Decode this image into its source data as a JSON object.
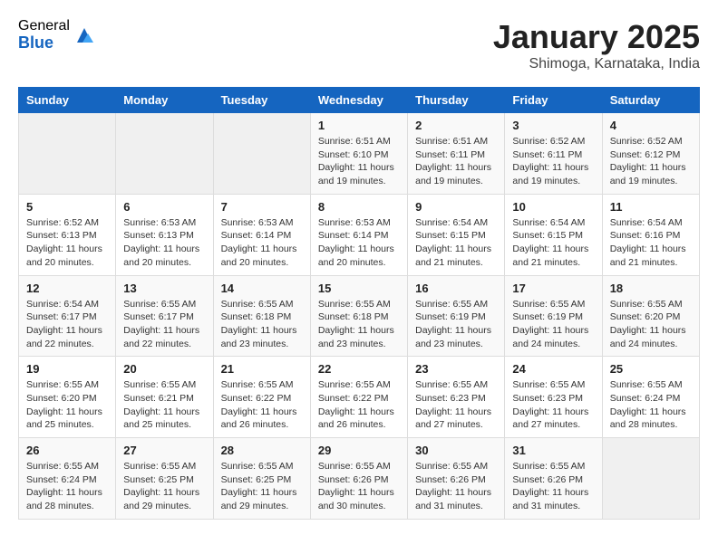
{
  "header": {
    "logo_general": "General",
    "logo_blue": "Blue",
    "month_title": "January 2025",
    "subtitle": "Shimoga, Karnataka, India"
  },
  "weekdays": [
    "Sunday",
    "Monday",
    "Tuesday",
    "Wednesday",
    "Thursday",
    "Friday",
    "Saturday"
  ],
  "weeks": [
    [
      {
        "day": "",
        "info": ""
      },
      {
        "day": "",
        "info": ""
      },
      {
        "day": "",
        "info": ""
      },
      {
        "day": "1",
        "info": "Sunrise: 6:51 AM\nSunset: 6:10 PM\nDaylight: 11 hours\nand 19 minutes."
      },
      {
        "day": "2",
        "info": "Sunrise: 6:51 AM\nSunset: 6:11 PM\nDaylight: 11 hours\nand 19 minutes."
      },
      {
        "day": "3",
        "info": "Sunrise: 6:52 AM\nSunset: 6:11 PM\nDaylight: 11 hours\nand 19 minutes."
      },
      {
        "day": "4",
        "info": "Sunrise: 6:52 AM\nSunset: 6:12 PM\nDaylight: 11 hours\nand 19 minutes."
      }
    ],
    [
      {
        "day": "5",
        "info": "Sunrise: 6:52 AM\nSunset: 6:13 PM\nDaylight: 11 hours\nand 20 minutes."
      },
      {
        "day": "6",
        "info": "Sunrise: 6:53 AM\nSunset: 6:13 PM\nDaylight: 11 hours\nand 20 minutes."
      },
      {
        "day": "7",
        "info": "Sunrise: 6:53 AM\nSunset: 6:14 PM\nDaylight: 11 hours\nand 20 minutes."
      },
      {
        "day": "8",
        "info": "Sunrise: 6:53 AM\nSunset: 6:14 PM\nDaylight: 11 hours\nand 20 minutes."
      },
      {
        "day": "9",
        "info": "Sunrise: 6:54 AM\nSunset: 6:15 PM\nDaylight: 11 hours\nand 21 minutes."
      },
      {
        "day": "10",
        "info": "Sunrise: 6:54 AM\nSunset: 6:15 PM\nDaylight: 11 hours\nand 21 minutes."
      },
      {
        "day": "11",
        "info": "Sunrise: 6:54 AM\nSunset: 6:16 PM\nDaylight: 11 hours\nand 21 minutes."
      }
    ],
    [
      {
        "day": "12",
        "info": "Sunrise: 6:54 AM\nSunset: 6:17 PM\nDaylight: 11 hours\nand 22 minutes."
      },
      {
        "day": "13",
        "info": "Sunrise: 6:55 AM\nSunset: 6:17 PM\nDaylight: 11 hours\nand 22 minutes."
      },
      {
        "day": "14",
        "info": "Sunrise: 6:55 AM\nSunset: 6:18 PM\nDaylight: 11 hours\nand 23 minutes."
      },
      {
        "day": "15",
        "info": "Sunrise: 6:55 AM\nSunset: 6:18 PM\nDaylight: 11 hours\nand 23 minutes."
      },
      {
        "day": "16",
        "info": "Sunrise: 6:55 AM\nSunset: 6:19 PM\nDaylight: 11 hours\nand 23 minutes."
      },
      {
        "day": "17",
        "info": "Sunrise: 6:55 AM\nSunset: 6:19 PM\nDaylight: 11 hours\nand 24 minutes."
      },
      {
        "day": "18",
        "info": "Sunrise: 6:55 AM\nSunset: 6:20 PM\nDaylight: 11 hours\nand 24 minutes."
      }
    ],
    [
      {
        "day": "19",
        "info": "Sunrise: 6:55 AM\nSunset: 6:20 PM\nDaylight: 11 hours\nand 25 minutes."
      },
      {
        "day": "20",
        "info": "Sunrise: 6:55 AM\nSunset: 6:21 PM\nDaylight: 11 hours\nand 25 minutes."
      },
      {
        "day": "21",
        "info": "Sunrise: 6:55 AM\nSunset: 6:22 PM\nDaylight: 11 hours\nand 26 minutes."
      },
      {
        "day": "22",
        "info": "Sunrise: 6:55 AM\nSunset: 6:22 PM\nDaylight: 11 hours\nand 26 minutes."
      },
      {
        "day": "23",
        "info": "Sunrise: 6:55 AM\nSunset: 6:23 PM\nDaylight: 11 hours\nand 27 minutes."
      },
      {
        "day": "24",
        "info": "Sunrise: 6:55 AM\nSunset: 6:23 PM\nDaylight: 11 hours\nand 27 minutes."
      },
      {
        "day": "25",
        "info": "Sunrise: 6:55 AM\nSunset: 6:24 PM\nDaylight: 11 hours\nand 28 minutes."
      }
    ],
    [
      {
        "day": "26",
        "info": "Sunrise: 6:55 AM\nSunset: 6:24 PM\nDaylight: 11 hours\nand 28 minutes."
      },
      {
        "day": "27",
        "info": "Sunrise: 6:55 AM\nSunset: 6:25 PM\nDaylight: 11 hours\nand 29 minutes."
      },
      {
        "day": "28",
        "info": "Sunrise: 6:55 AM\nSunset: 6:25 PM\nDaylight: 11 hours\nand 29 minutes."
      },
      {
        "day": "29",
        "info": "Sunrise: 6:55 AM\nSunset: 6:26 PM\nDaylight: 11 hours\nand 30 minutes."
      },
      {
        "day": "30",
        "info": "Sunrise: 6:55 AM\nSunset: 6:26 PM\nDaylight: 11 hours\nand 31 minutes."
      },
      {
        "day": "31",
        "info": "Sunrise: 6:55 AM\nSunset: 6:26 PM\nDaylight: 11 hours\nand 31 minutes."
      },
      {
        "day": "",
        "info": ""
      }
    ]
  ]
}
